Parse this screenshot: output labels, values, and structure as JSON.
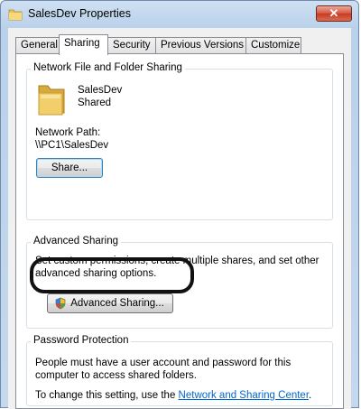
{
  "window": {
    "title": "SalesDev Properties",
    "close_label": "✕"
  },
  "tabs": [
    {
      "label": "General"
    },
    {
      "label": "Sharing"
    },
    {
      "label": "Security"
    },
    {
      "label": "Previous Versions"
    },
    {
      "label": "Customize"
    }
  ],
  "network_sharing": {
    "group_title": "Network File and Folder Sharing",
    "folder_name": "SalesDev",
    "folder_status": "Shared",
    "path_label": "Network Path:",
    "path_value": "\\\\PC1\\SalesDev",
    "share_button": "Share..."
  },
  "advanced_sharing": {
    "group_title": "Advanced Sharing",
    "description_line1": "Set custom permissions, create multiple shares, and set other",
    "description_line2": "advanced sharing options.",
    "button_label": "Advanced Sharing..."
  },
  "password_protection": {
    "group_title": "Password Protection",
    "line1": "People must have a user account and password for this",
    "line2": "computer to access shared folders.",
    "change_prefix": "To change this setting, use the ",
    "link_text": "Network and Sharing Center",
    "change_suffix": "."
  },
  "colors": {
    "link": "#0066cc",
    "close_button": "#c63a22",
    "title_bar": "#b9d1ea"
  }
}
